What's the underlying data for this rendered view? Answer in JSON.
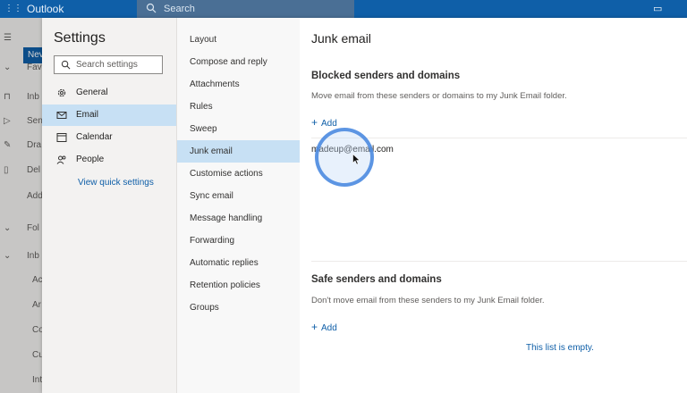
{
  "app": {
    "title": "Outlook"
  },
  "topbar": {
    "search_placeholder": "Search"
  },
  "left_rail": {
    "new_label": "Nev",
    "rows": [
      {
        "label": "Fav"
      },
      {
        "label": "Inb"
      },
      {
        "label": "Sen"
      },
      {
        "label": "Dra"
      },
      {
        "label": "Del"
      },
      {
        "label": "Add"
      },
      {
        "label": "Fol"
      },
      {
        "label": "Inb"
      },
      {
        "label": "Ac"
      },
      {
        "label": "Ar"
      },
      {
        "label": "Co"
      },
      {
        "label": "Cu"
      },
      {
        "label": "Int"
      }
    ]
  },
  "settings": {
    "title": "Settings",
    "search_placeholder": "Search settings",
    "categories": [
      {
        "label": "General"
      },
      {
        "label": "Email"
      },
      {
        "label": "Calendar"
      },
      {
        "label": "People"
      }
    ],
    "quick_link": "View quick settings",
    "email_sections": [
      {
        "label": "Layout"
      },
      {
        "label": "Compose and reply"
      },
      {
        "label": "Attachments"
      },
      {
        "label": "Rules"
      },
      {
        "label": "Sweep"
      },
      {
        "label": "Junk email"
      },
      {
        "label": "Customise actions"
      },
      {
        "label": "Sync email"
      },
      {
        "label": "Message handling"
      },
      {
        "label": "Forwarding"
      },
      {
        "label": "Automatic replies"
      },
      {
        "label": "Retention policies"
      },
      {
        "label": "Groups"
      }
    ]
  },
  "junk": {
    "title": "Junk email",
    "blocked": {
      "title": "Blocked senders and domains",
      "description": "Move email from these senders or domains to my Junk Email folder.",
      "add_label": "Add",
      "entries": [
        "madeup@email.com"
      ]
    },
    "safe": {
      "title": "Safe senders and domains",
      "description": "Don't move email from these senders to my Junk Email folder.",
      "add_label": "Add",
      "empty_text": "This list is empty."
    }
  },
  "colors": {
    "brand": "#0f5fa8",
    "selection": "#c7e0f4"
  }
}
